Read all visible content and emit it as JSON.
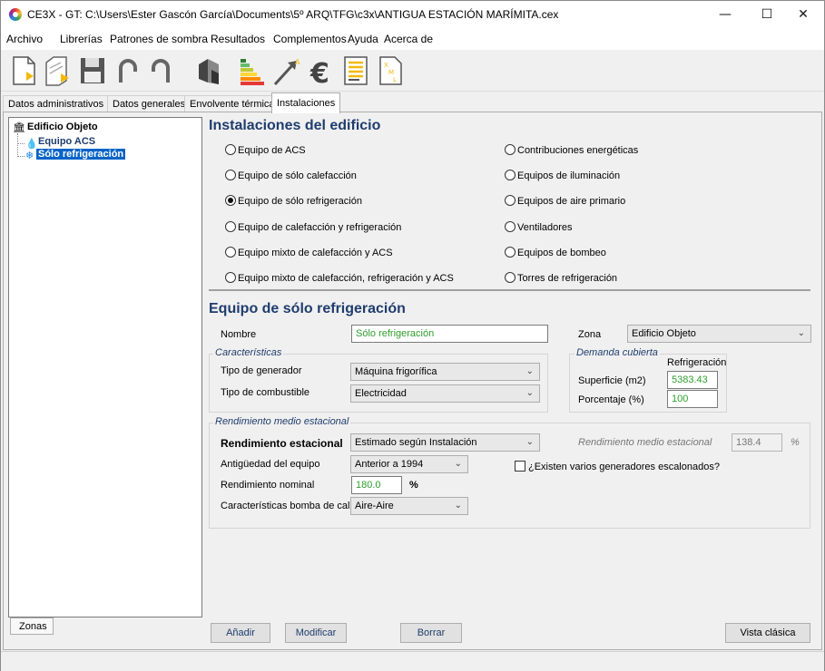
{
  "window": {
    "title": "CE3X - GT: C:\\Users\\Ester Gascón García\\Documents\\5º ARQ\\TFG\\c3x\\ANTIGUA ESTACIÓN MARÍMITA.cex",
    "minimize": "—",
    "maximize": "☐",
    "close": "✕"
  },
  "menu": [
    "Archivo",
    "Librerías",
    "Patrones de sombra",
    "Resultados",
    "Complementos",
    "Ayuda",
    "Acerca de"
  ],
  "toolbar": {
    "icons": [
      "new-file-icon",
      "open-file-icon",
      "save-icon",
      "undo-icon",
      "redo-icon",
      "building-icon",
      "energy-rating-icon",
      "improvement-measures-icon",
      "euro-icon",
      "report-icon",
      "xml-export-icon"
    ]
  },
  "tabs": [
    "Datos administrativos",
    "Datos generales",
    "Envolvente térmica",
    "Instalaciones"
  ],
  "tree": {
    "root": "Edificio Objeto",
    "items": [
      "Equipo ACS",
      "Sólo refrigeración"
    ],
    "bottom_tab": "Zonas"
  },
  "installations": {
    "heading": "Instalaciones del edificio",
    "left_options": [
      "Equipo de ACS",
      "Equipo de sólo calefacción",
      "Equipo de sólo refrigeración",
      "Equipo de calefacción y refrigeración",
      "Equipo mixto de calefacción y ACS",
      "Equipo mixto de calefacción, refrigeración y ACS"
    ],
    "right_options": [
      "Contribuciones energéticas",
      "Equipos de iluminación",
      "Equipos de aire primario",
      "Ventiladores",
      "Equipos de bombeo",
      "Torres de refrigeración"
    ],
    "selected": "Equipo de sólo refrigeración"
  },
  "equipment": {
    "heading": "Equipo de sólo refrigeración",
    "name_label": "Nombre",
    "name_value": "Sólo refrigeración",
    "zone_label": "Zona",
    "zone_value": "Edificio Objeto",
    "characteristics": {
      "title": "Características",
      "generator_label": "Tipo de generador",
      "generator_value": "Máquina frigorífica",
      "fuel_label": "Tipo de combustible",
      "fuel_value": "Electricidad"
    },
    "demand": {
      "title": "Demanda cubierta",
      "column": "Refrigeración",
      "surface_label": "Superficie (m2)",
      "surface_value": "5383.43",
      "percent_label": "Porcentaje (%)",
      "percent_value": "100"
    },
    "performance": {
      "title": "Rendimiento medio estacional",
      "seasonal_label": "Rendimiento estacional",
      "seasonal_value": "Estimado según Instalación",
      "avg_label": "Rendimiento medio estacional",
      "avg_value": "138.4",
      "avg_unit": "%",
      "age_label": "Antigüedad del equipo",
      "age_value": "Anterior a 1994",
      "multi_gen_label": "¿Existen varios generadores escalonados?",
      "nominal_label": "Rendimiento nominal",
      "nominal_value": "180.0",
      "nominal_unit": "%",
      "heatpump_label": "Características bomba de calor",
      "heatpump_value": "Aire-Aire"
    }
  },
  "buttons": {
    "add": "Añadir",
    "modify": "Modificar",
    "delete": "Borrar",
    "classic": "Vista clásica"
  }
}
